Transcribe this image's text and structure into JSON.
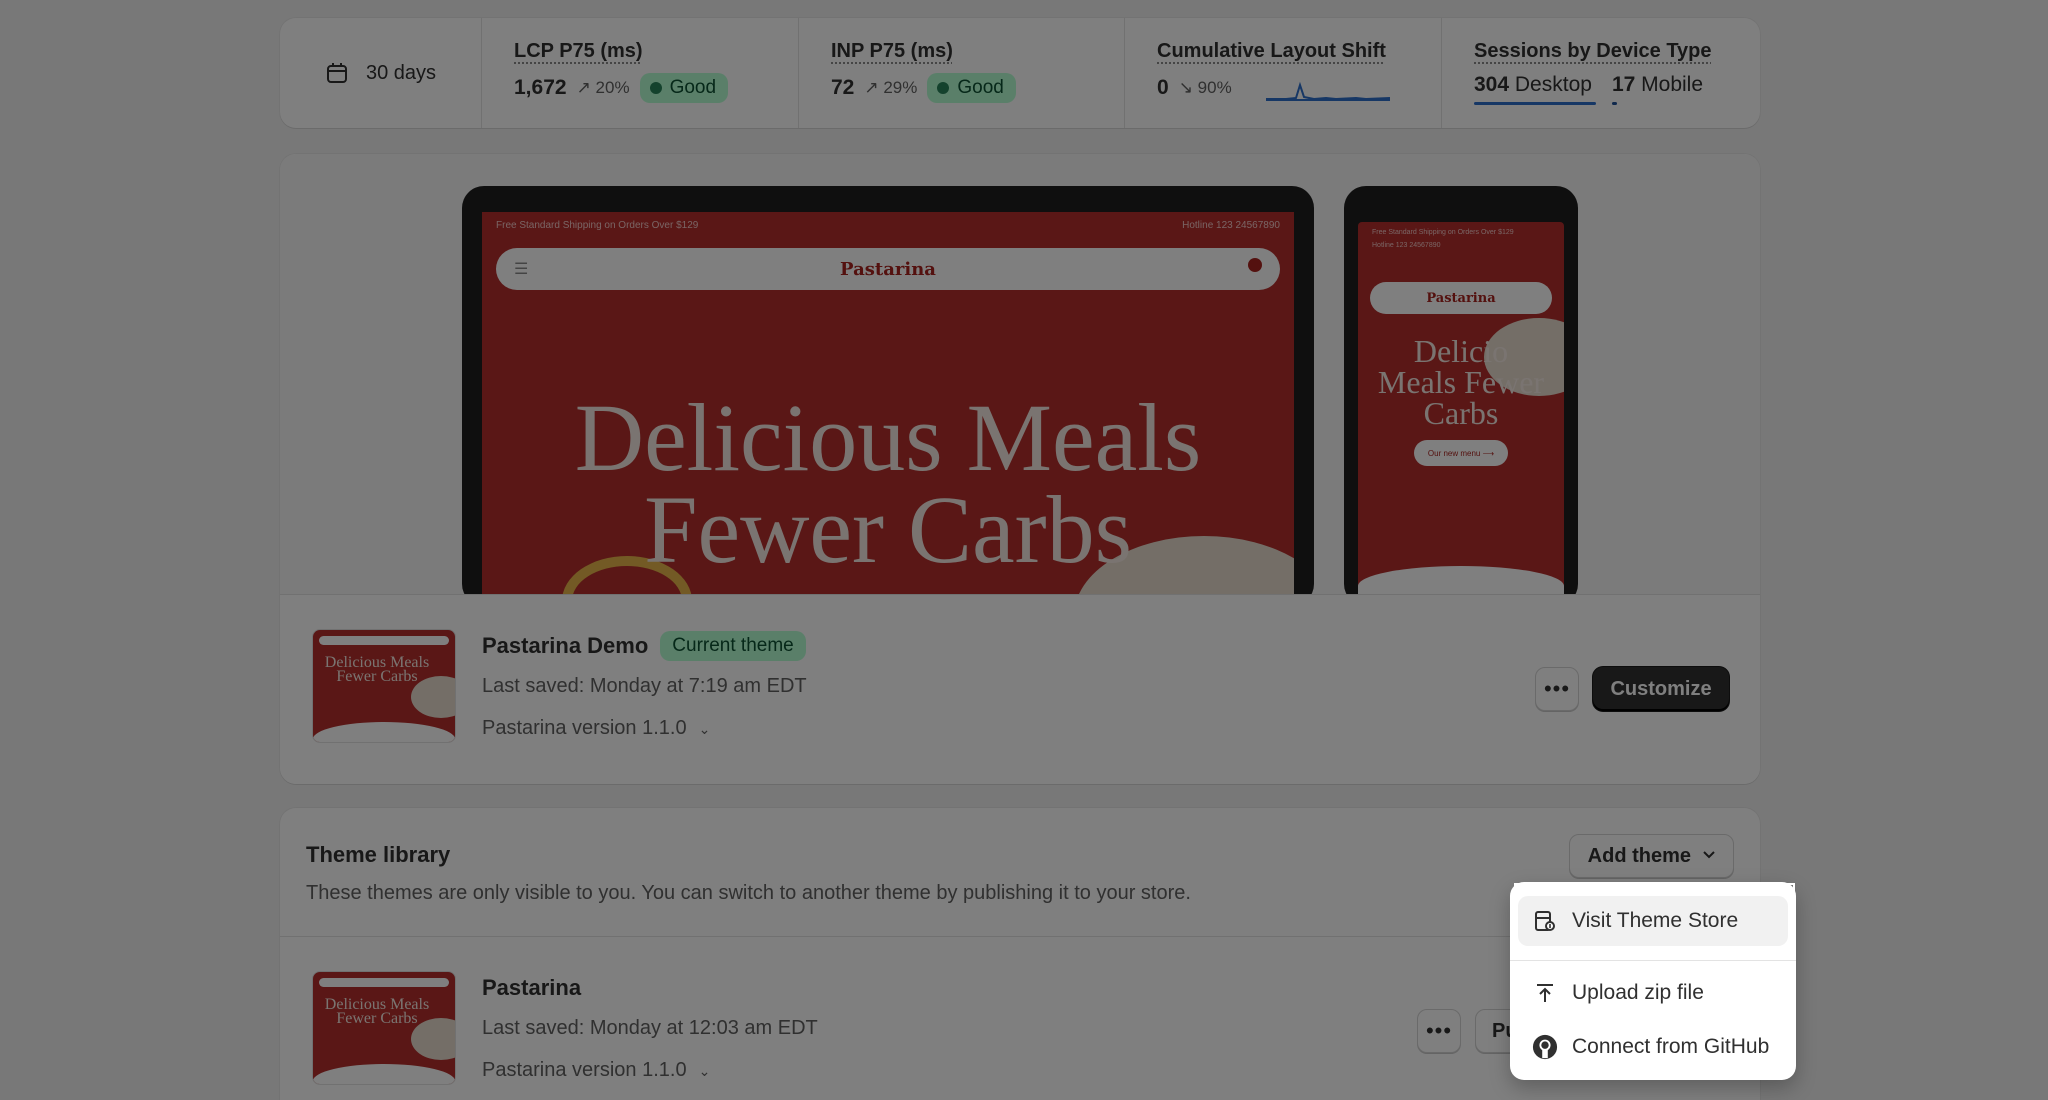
{
  "metrics": {
    "date_range": "30 days",
    "lcp": {
      "title": "LCP P75 (ms)",
      "value": "1,672",
      "delta": "20%",
      "status": "Good"
    },
    "inp": {
      "title": "INP P75 (ms)",
      "value": "72",
      "delta": "29%",
      "status": "Good"
    },
    "cls": {
      "title": "Cumulative Layout Shift",
      "value": "0",
      "delta": "90%"
    },
    "sessions": {
      "title": "Sessions by Device Type",
      "desktop_count": "304",
      "desktop_label": "Desktop",
      "mobile_count": "17",
      "mobile_label": "Mobile"
    }
  },
  "preview": {
    "shipping_text": "Free Standard Shipping on Orders Over $129",
    "hotline": "Hotline 123 24567890",
    "logo": "Pastarina",
    "headline_line1": "Delicious Meals",
    "headline_line2": "Fewer Carbs",
    "phone_headline_line1": "Delicio",
    "phone_headline_line2": "Meals Fewer",
    "phone_headline_line3": "Carbs",
    "phone_cta": "Our new menu ⟶"
  },
  "current_theme": {
    "name": "Pastarina Demo",
    "badge": "Current theme",
    "last_saved": "Last saved: Monday at 7:19 am EDT",
    "version": "Pastarina version 1.1.0",
    "customize_label": "Customize",
    "more_label": "•••"
  },
  "library": {
    "title": "Theme library",
    "description": "These themes are only visible to you. You can switch to another theme by publishing it to your store.",
    "add_theme_label": "Add theme",
    "themes": [
      {
        "name": "Pastarina",
        "last_saved": "Last saved: Monday at 12:03 am EDT",
        "version": "Pastarina version 1.1.0",
        "publish_label_partial": "Pu"
      }
    ]
  },
  "thumbnail": {
    "line1": "Delicious Meals",
    "line2": "Fewer Carbs"
  },
  "add_theme_menu": {
    "items": [
      {
        "label": "Visit Theme Store",
        "icon": "theme-store-icon"
      },
      {
        "label": "Upload zip file",
        "icon": "upload-icon"
      },
      {
        "label": "Connect from GitHub",
        "icon": "github-icon"
      }
    ]
  },
  "colors": {
    "good_badge_bg": "#b4fed2",
    "good_badge_text": "#0c5132",
    "primary_button": "#303030",
    "theme_red": "#b52e2c",
    "desktop_bar": "#2c6ecb",
    "mobile_bar": "#1f5199"
  }
}
